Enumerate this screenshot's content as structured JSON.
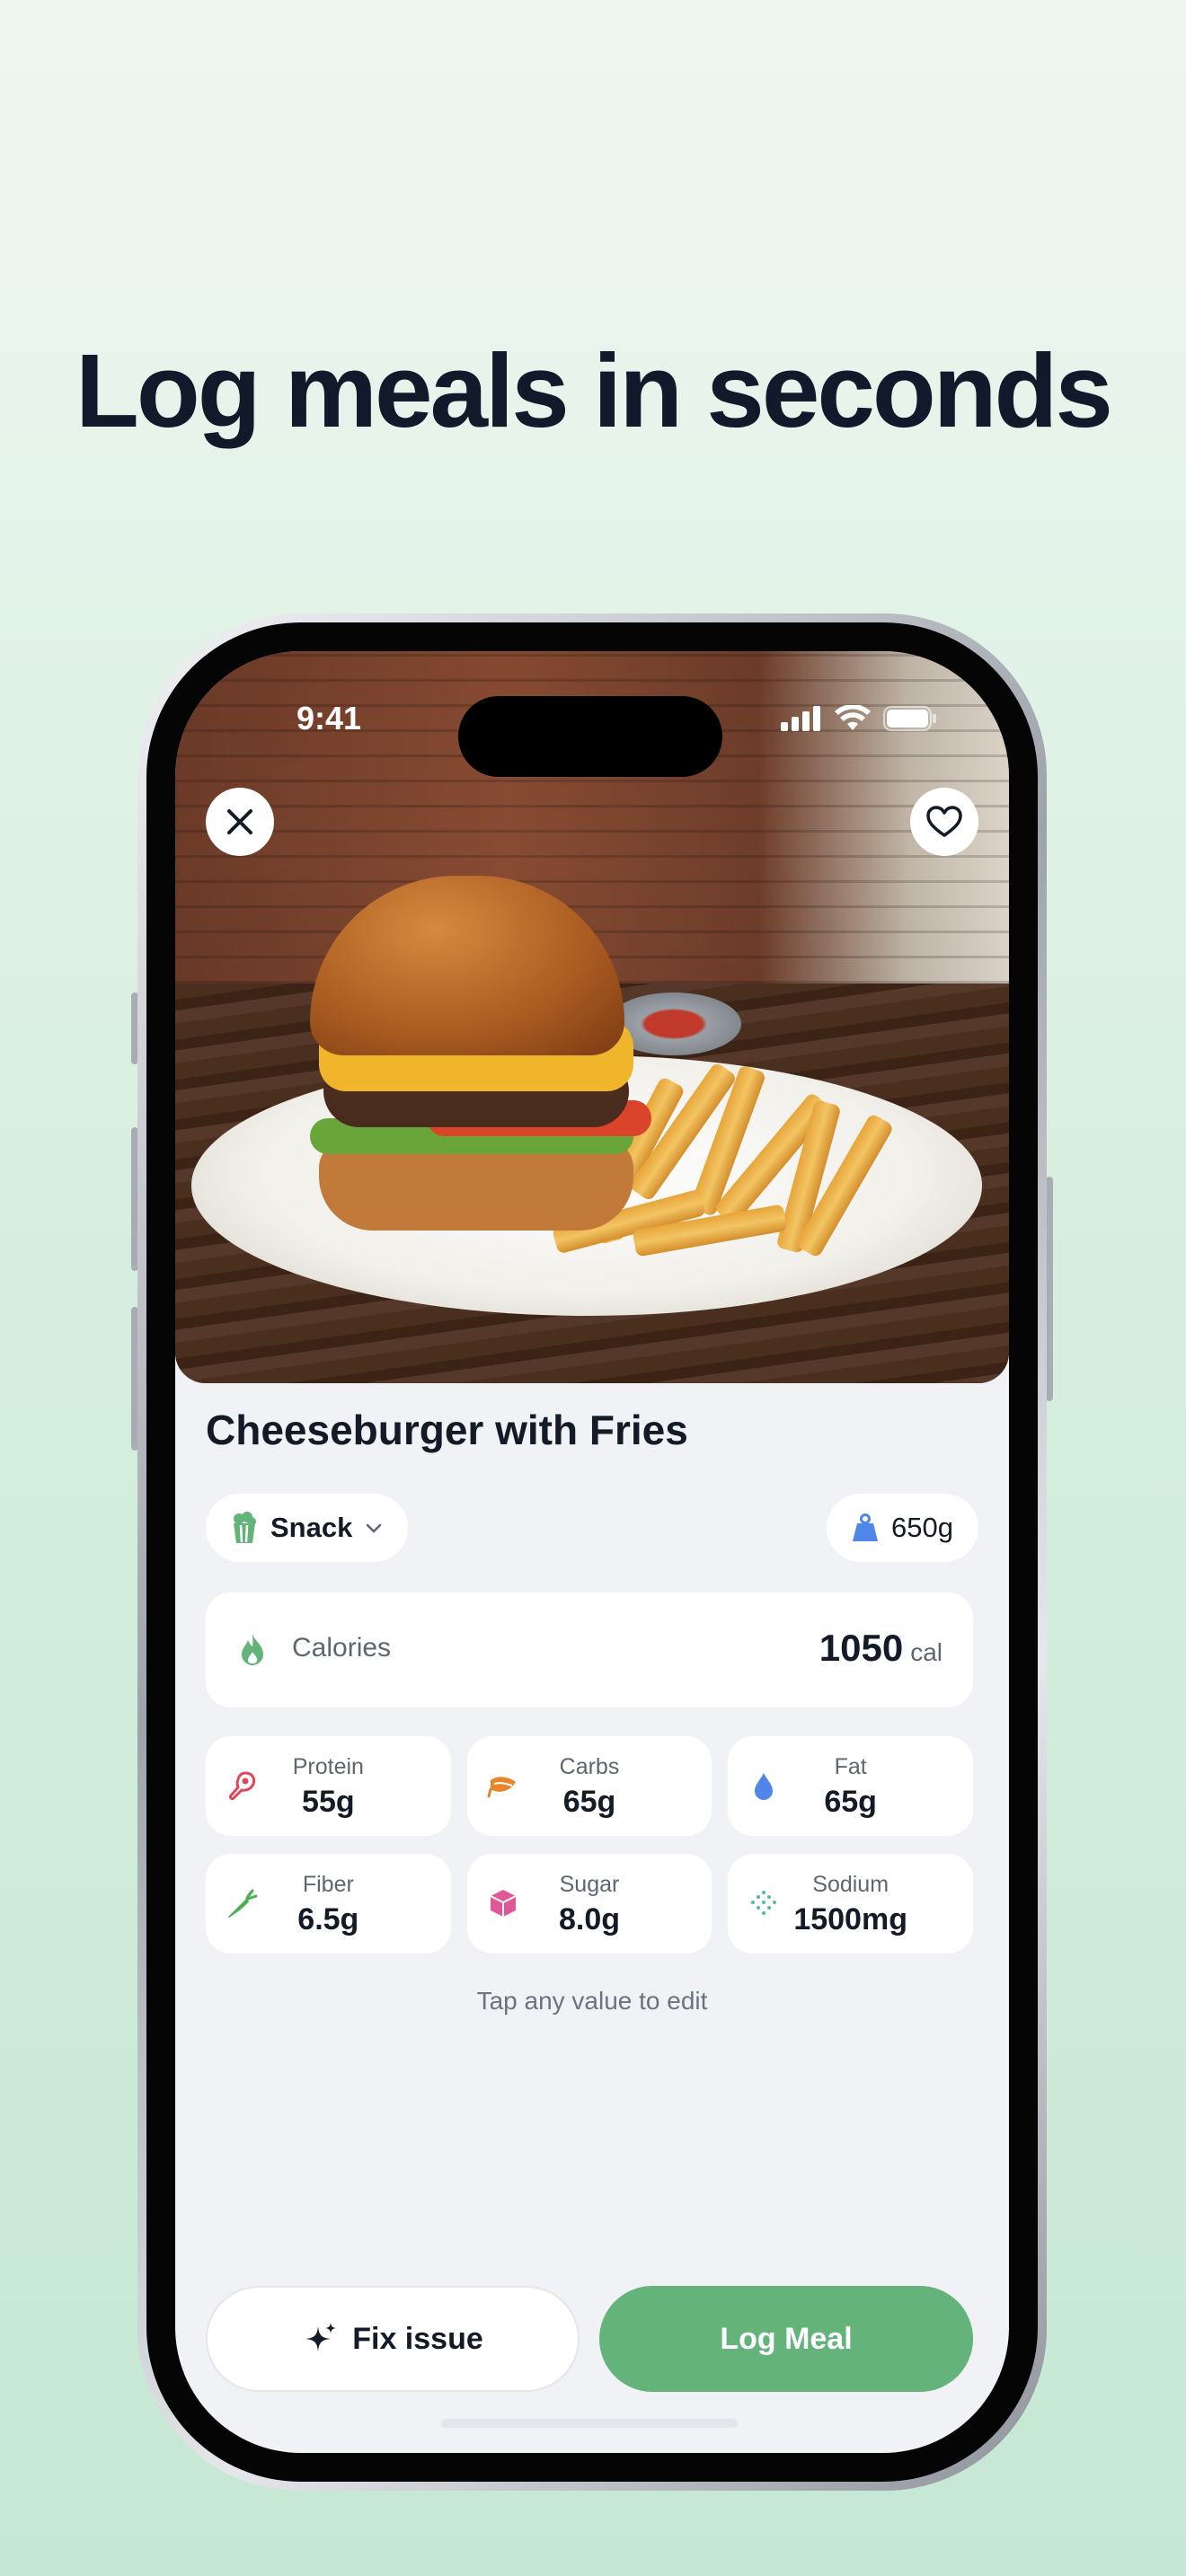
{
  "headline": "Log meals in seconds",
  "status_bar": {
    "time": "9:41"
  },
  "meal": {
    "title": "Cheeseburger with Fries",
    "category": "Snack",
    "weight": "650g"
  },
  "calories": {
    "label": "Calories",
    "value": "1050",
    "unit": "cal"
  },
  "nutrients": [
    {
      "label": "Protein",
      "value": "55g",
      "icon": "meat-icon",
      "color": "#e0475a"
    },
    {
      "label": "Carbs",
      "value": "65g",
      "icon": "grain-icon",
      "color": "#e8852b"
    },
    {
      "label": "Fat",
      "value": "65g",
      "icon": "droplet-icon",
      "color": "#4f86e8"
    },
    {
      "label": "Fiber",
      "value": "6.5g",
      "icon": "carrot-icon",
      "color": "#4caf50"
    },
    {
      "label": "Sugar",
      "value": "8.0g",
      "icon": "cube-icon",
      "color": "#e0589a"
    },
    {
      "label": "Sodium",
      "value": "1500mg",
      "icon": "salt-icon",
      "color": "#5bb7a8"
    }
  ],
  "hint": "Tap any value to edit",
  "buttons": {
    "fix": "Fix issue",
    "log": "Log Meal"
  },
  "colors": {
    "accent": "#64b37b",
    "text": "#141a26"
  }
}
